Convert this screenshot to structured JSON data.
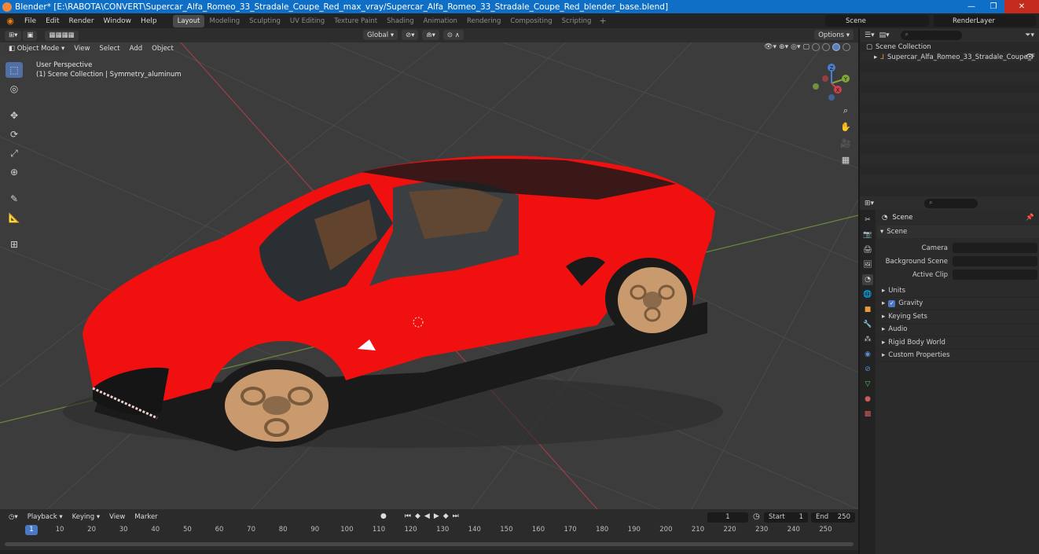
{
  "window": {
    "title": "Blender* [E:\\RABOTA\\CONVERT\\Supercar_Alfa_Romeo_33_Stradale_Coupe_Red_max_vray/Supercar_Alfa_Romeo_33_Stradale_Coupe_Red_blender_base.blend]",
    "minimize": "—",
    "maximize": "❐",
    "close": "✕"
  },
  "menubar": {
    "items": [
      "File",
      "Edit",
      "Render",
      "Window",
      "Help"
    ],
    "workspaces": [
      "Layout",
      "Modeling",
      "Sculpting",
      "UV Editing",
      "Texture Paint",
      "Shading",
      "Animation",
      "Rendering",
      "Compositing",
      "Scripting"
    ],
    "active_workspace": "Layout",
    "scene": "Scene",
    "render_layer": "RenderLayer"
  },
  "viewport_header": {
    "transform_orientation": "Global",
    "options": "Options",
    "mode": "Object Mode",
    "menus": [
      "View",
      "Select",
      "Add",
      "Object"
    ]
  },
  "viewport": {
    "perspective": "User Perspective",
    "collection_info": "(1) Scene Collection | Symmetry_aluminum",
    "axes": {
      "x": "X",
      "y": "Y",
      "z": "Z"
    },
    "colors": {
      "background": "#3c3c3c",
      "x_axis": "#c8404a",
      "y_axis": "#7fa83a",
      "car_body": "#f01010",
      "wheel": "#c99a6e"
    }
  },
  "timeline": {
    "menus": [
      "Playback",
      "Keying",
      "View",
      "Marker"
    ],
    "current_frame": "1",
    "start_label": "Start",
    "start": "1",
    "end_label": "End",
    "end": "250",
    "ticks": [
      "10",
      "20",
      "30",
      "40",
      "50",
      "60",
      "70",
      "80",
      "90",
      "100",
      "110",
      "120",
      "130",
      "140",
      "150",
      "160",
      "170",
      "180",
      "190",
      "200",
      "210",
      "220",
      "230",
      "240",
      "250"
    ]
  },
  "outliner": {
    "root": "Scene Collection",
    "object": "Supercar_Alfa_Romeo_33_Stradale_Coupe_F"
  },
  "properties": {
    "context": "Scene",
    "panel": "Scene",
    "camera_label": "Camera",
    "background_label": "Background Scene",
    "active_clip_label": "Active Clip",
    "subpanels": [
      "Units",
      "Gravity",
      "Keying Sets",
      "Audio",
      "Rigid Body World",
      "Custom Properties"
    ]
  }
}
